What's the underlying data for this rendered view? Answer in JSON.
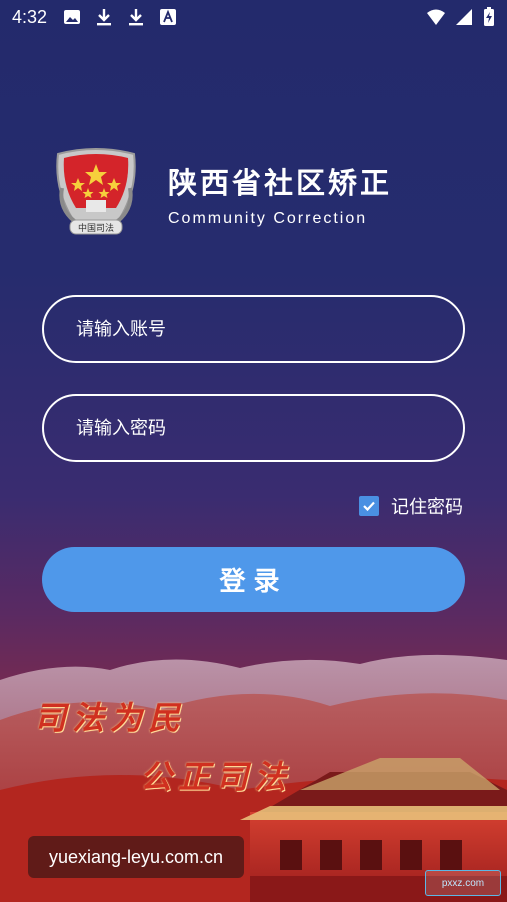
{
  "status_bar": {
    "time": "4:32",
    "left_icons": [
      "image-icon",
      "download-icon",
      "download-icon",
      "text-a-icon"
    ],
    "right_icons": [
      "wifi-icon",
      "signal-icon",
      "battery-icon"
    ]
  },
  "brand": {
    "emblem_text": "中国司法",
    "title": "陕西省社区矫正",
    "subtitle": "Community Correction"
  },
  "form": {
    "account_placeholder": "请输入账号",
    "password_placeholder": "请输入密码",
    "remember_label": "记住密码",
    "remember_checked": true,
    "login_label": "登录"
  },
  "banner": {
    "slogan_1": "司法为民",
    "slogan_2": "公正司法"
  },
  "watermarks": {
    "left": "yuexiang-leyu.com.cn",
    "right": "pxxz.com"
  },
  "colors": {
    "accent": "#4f98ea",
    "checkbox": "#4a90e2",
    "background_top": "#232a6c",
    "background_bottom": "#b22222"
  }
}
